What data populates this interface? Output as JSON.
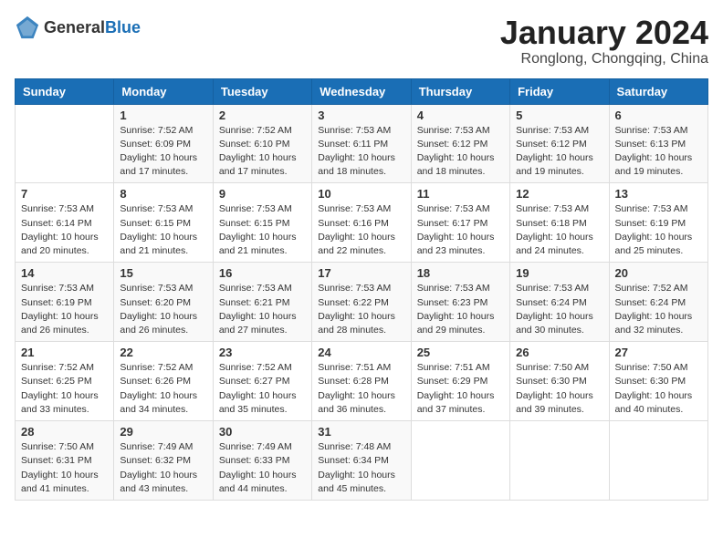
{
  "header": {
    "logo_general": "General",
    "logo_blue": "Blue",
    "month_title": "January 2024",
    "subtitle": "Ronglong, Chongqing, China"
  },
  "weekdays": [
    "Sunday",
    "Monday",
    "Tuesday",
    "Wednesday",
    "Thursday",
    "Friday",
    "Saturday"
  ],
  "weeks": [
    [
      {
        "day": "",
        "sunrise": "",
        "sunset": "",
        "daylight": ""
      },
      {
        "day": "1",
        "sunrise": "Sunrise: 7:52 AM",
        "sunset": "Sunset: 6:09 PM",
        "daylight": "Daylight: 10 hours and 17 minutes."
      },
      {
        "day": "2",
        "sunrise": "Sunrise: 7:52 AM",
        "sunset": "Sunset: 6:10 PM",
        "daylight": "Daylight: 10 hours and 17 minutes."
      },
      {
        "day": "3",
        "sunrise": "Sunrise: 7:53 AM",
        "sunset": "Sunset: 6:11 PM",
        "daylight": "Daylight: 10 hours and 18 minutes."
      },
      {
        "day": "4",
        "sunrise": "Sunrise: 7:53 AM",
        "sunset": "Sunset: 6:12 PM",
        "daylight": "Daylight: 10 hours and 18 minutes."
      },
      {
        "day": "5",
        "sunrise": "Sunrise: 7:53 AM",
        "sunset": "Sunset: 6:12 PM",
        "daylight": "Daylight: 10 hours and 19 minutes."
      },
      {
        "day": "6",
        "sunrise": "Sunrise: 7:53 AM",
        "sunset": "Sunset: 6:13 PM",
        "daylight": "Daylight: 10 hours and 19 minutes."
      }
    ],
    [
      {
        "day": "7",
        "sunrise": "Sunrise: 7:53 AM",
        "sunset": "Sunset: 6:14 PM",
        "daylight": "Daylight: 10 hours and 20 minutes."
      },
      {
        "day": "8",
        "sunrise": "Sunrise: 7:53 AM",
        "sunset": "Sunset: 6:15 PM",
        "daylight": "Daylight: 10 hours and 21 minutes."
      },
      {
        "day": "9",
        "sunrise": "Sunrise: 7:53 AM",
        "sunset": "Sunset: 6:15 PM",
        "daylight": "Daylight: 10 hours and 21 minutes."
      },
      {
        "day": "10",
        "sunrise": "Sunrise: 7:53 AM",
        "sunset": "Sunset: 6:16 PM",
        "daylight": "Daylight: 10 hours and 22 minutes."
      },
      {
        "day": "11",
        "sunrise": "Sunrise: 7:53 AM",
        "sunset": "Sunset: 6:17 PM",
        "daylight": "Daylight: 10 hours and 23 minutes."
      },
      {
        "day": "12",
        "sunrise": "Sunrise: 7:53 AM",
        "sunset": "Sunset: 6:18 PM",
        "daylight": "Daylight: 10 hours and 24 minutes."
      },
      {
        "day": "13",
        "sunrise": "Sunrise: 7:53 AM",
        "sunset": "Sunset: 6:19 PM",
        "daylight": "Daylight: 10 hours and 25 minutes."
      }
    ],
    [
      {
        "day": "14",
        "sunrise": "Sunrise: 7:53 AM",
        "sunset": "Sunset: 6:19 PM",
        "daylight": "Daylight: 10 hours and 26 minutes."
      },
      {
        "day": "15",
        "sunrise": "Sunrise: 7:53 AM",
        "sunset": "Sunset: 6:20 PM",
        "daylight": "Daylight: 10 hours and 26 minutes."
      },
      {
        "day": "16",
        "sunrise": "Sunrise: 7:53 AM",
        "sunset": "Sunset: 6:21 PM",
        "daylight": "Daylight: 10 hours and 27 minutes."
      },
      {
        "day": "17",
        "sunrise": "Sunrise: 7:53 AM",
        "sunset": "Sunset: 6:22 PM",
        "daylight": "Daylight: 10 hours and 28 minutes."
      },
      {
        "day": "18",
        "sunrise": "Sunrise: 7:53 AM",
        "sunset": "Sunset: 6:23 PM",
        "daylight": "Daylight: 10 hours and 29 minutes."
      },
      {
        "day": "19",
        "sunrise": "Sunrise: 7:53 AM",
        "sunset": "Sunset: 6:24 PM",
        "daylight": "Daylight: 10 hours and 30 minutes."
      },
      {
        "day": "20",
        "sunrise": "Sunrise: 7:52 AM",
        "sunset": "Sunset: 6:24 PM",
        "daylight": "Daylight: 10 hours and 32 minutes."
      }
    ],
    [
      {
        "day": "21",
        "sunrise": "Sunrise: 7:52 AM",
        "sunset": "Sunset: 6:25 PM",
        "daylight": "Daylight: 10 hours and 33 minutes."
      },
      {
        "day": "22",
        "sunrise": "Sunrise: 7:52 AM",
        "sunset": "Sunset: 6:26 PM",
        "daylight": "Daylight: 10 hours and 34 minutes."
      },
      {
        "day": "23",
        "sunrise": "Sunrise: 7:52 AM",
        "sunset": "Sunset: 6:27 PM",
        "daylight": "Daylight: 10 hours and 35 minutes."
      },
      {
        "day": "24",
        "sunrise": "Sunrise: 7:51 AM",
        "sunset": "Sunset: 6:28 PM",
        "daylight": "Daylight: 10 hours and 36 minutes."
      },
      {
        "day": "25",
        "sunrise": "Sunrise: 7:51 AM",
        "sunset": "Sunset: 6:29 PM",
        "daylight": "Daylight: 10 hours and 37 minutes."
      },
      {
        "day": "26",
        "sunrise": "Sunrise: 7:50 AM",
        "sunset": "Sunset: 6:30 PM",
        "daylight": "Daylight: 10 hours and 39 minutes."
      },
      {
        "day": "27",
        "sunrise": "Sunrise: 7:50 AM",
        "sunset": "Sunset: 6:30 PM",
        "daylight": "Daylight: 10 hours and 40 minutes."
      }
    ],
    [
      {
        "day": "28",
        "sunrise": "Sunrise: 7:50 AM",
        "sunset": "Sunset: 6:31 PM",
        "daylight": "Daylight: 10 hours and 41 minutes."
      },
      {
        "day": "29",
        "sunrise": "Sunrise: 7:49 AM",
        "sunset": "Sunset: 6:32 PM",
        "daylight": "Daylight: 10 hours and 43 minutes."
      },
      {
        "day": "30",
        "sunrise": "Sunrise: 7:49 AM",
        "sunset": "Sunset: 6:33 PM",
        "daylight": "Daylight: 10 hours and 44 minutes."
      },
      {
        "day": "31",
        "sunrise": "Sunrise: 7:48 AM",
        "sunset": "Sunset: 6:34 PM",
        "daylight": "Daylight: 10 hours and 45 minutes."
      },
      {
        "day": "",
        "sunrise": "",
        "sunset": "",
        "daylight": ""
      },
      {
        "day": "",
        "sunrise": "",
        "sunset": "",
        "daylight": ""
      },
      {
        "day": "",
        "sunrise": "",
        "sunset": "",
        "daylight": ""
      }
    ]
  ]
}
